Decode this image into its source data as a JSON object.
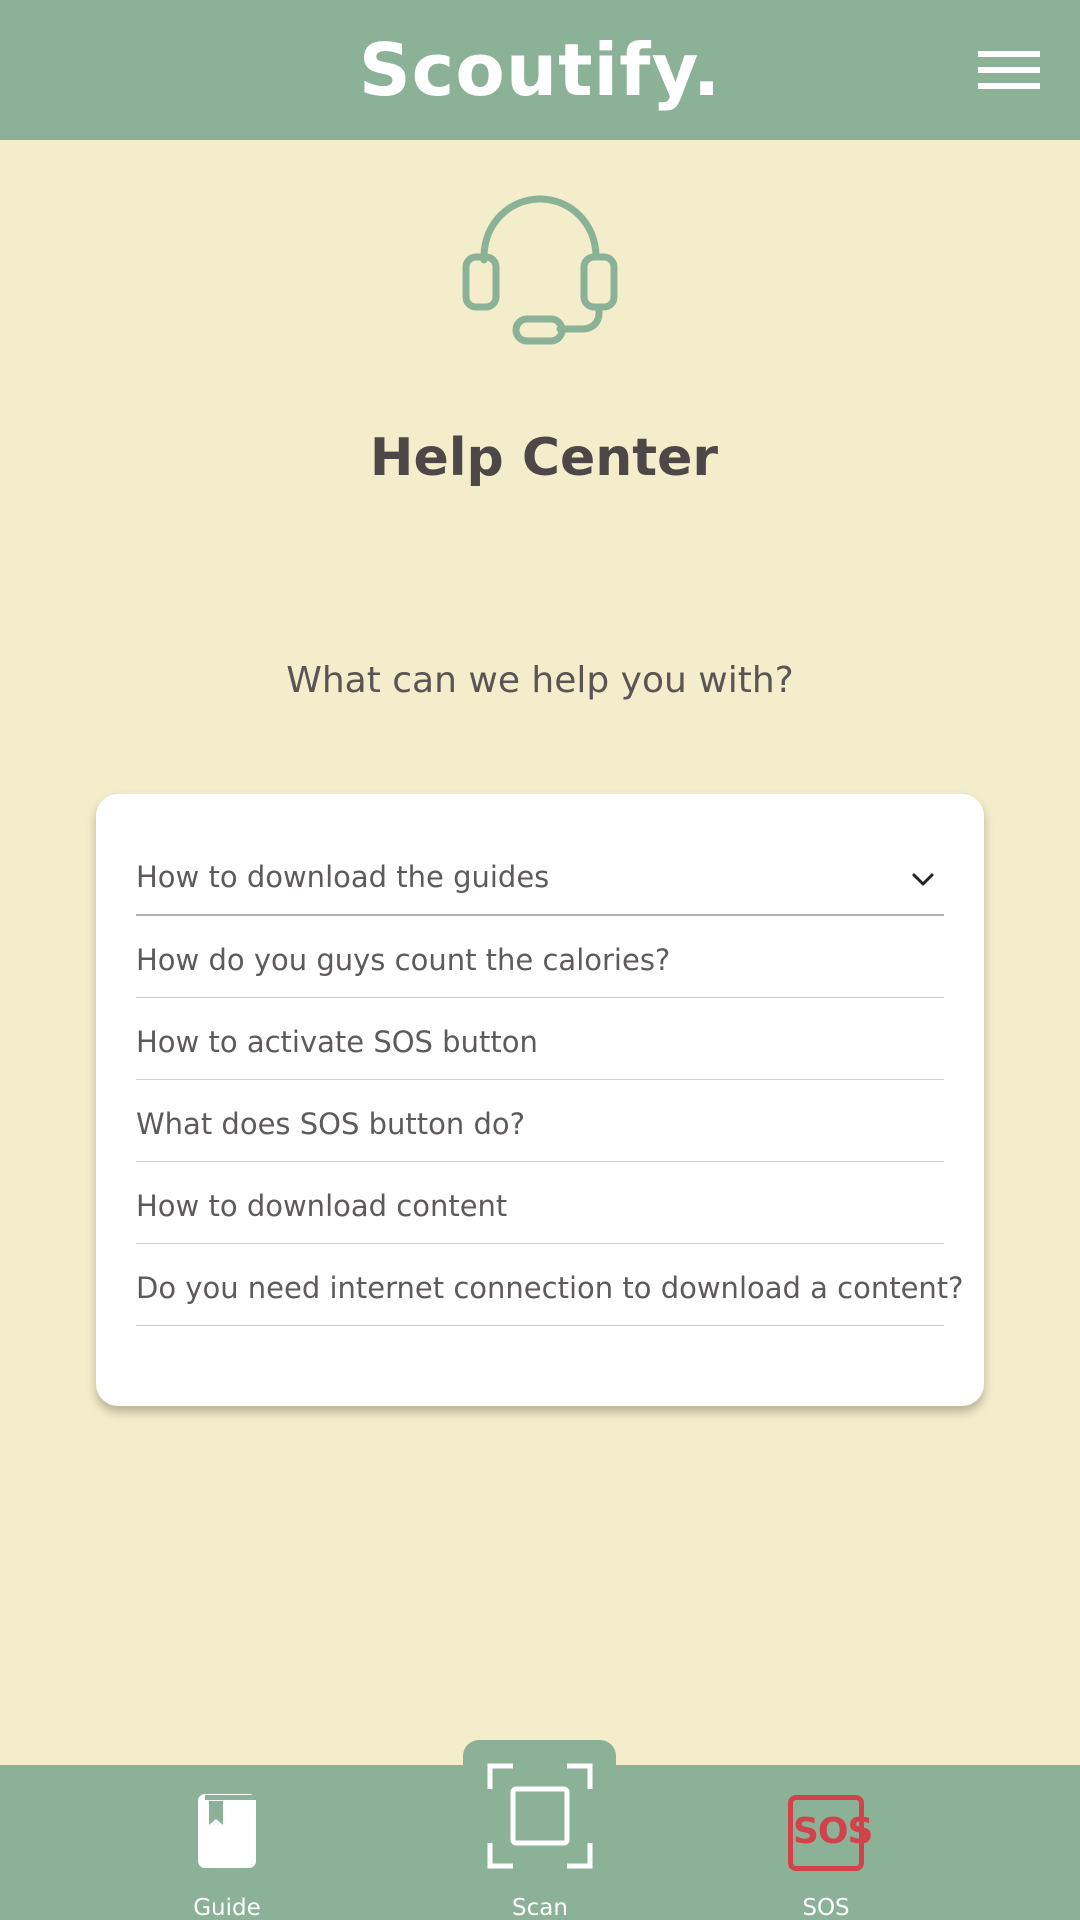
{
  "header": {
    "brand": "Scoutify."
  },
  "main": {
    "title": "Help Center",
    "subtitle": "What can we help you with?"
  },
  "faq": {
    "items": [
      {
        "question": "How to download the guides",
        "expanded": false
      },
      {
        "question": "How do you guys count the calories?"
      },
      {
        "question": "How to activate SOS button"
      },
      {
        "question": "What does SOS button do?"
      },
      {
        "question": "How to download content"
      },
      {
        "question": "Do you need internet connection to download a content?"
      }
    ]
  },
  "bottom_nav": {
    "items": [
      {
        "label": "Guide",
        "icon": "book-icon"
      },
      {
        "label": "Scan",
        "icon": "scan-frame-icon"
      },
      {
        "label": "SOS",
        "icon": "sos-icon",
        "icon_text": "SOS"
      }
    ]
  },
  "colors": {
    "header_bg": "#8BB297",
    "page_bg": "#F3EDCB",
    "sos_red": "#D2424A"
  }
}
